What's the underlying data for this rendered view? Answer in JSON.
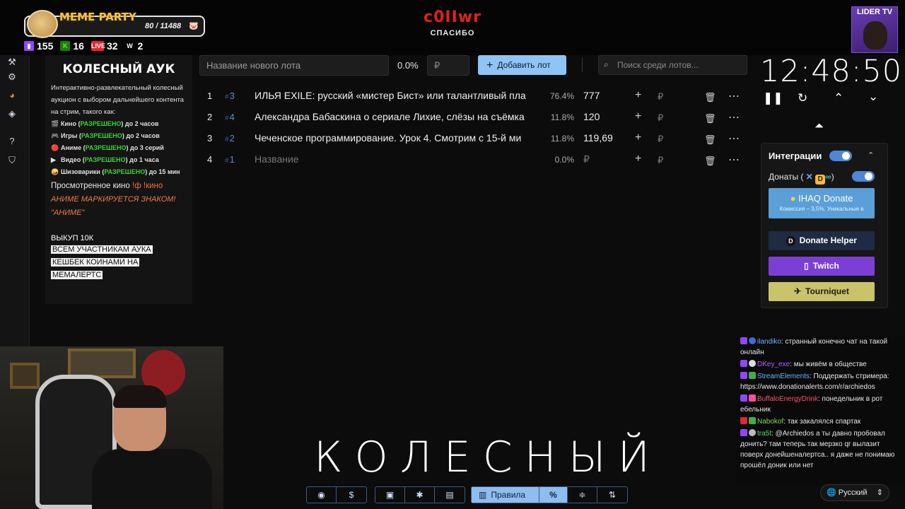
{
  "overlay": {
    "meme_title": "MEME PARTY",
    "meme_count": "80 / 11488",
    "meme_progress": 0.007,
    "stats": [
      {
        "icon": "twitch-icon",
        "color": "#9146ff",
        "value": "155"
      },
      {
        "icon": "kick-icon",
        "color": "#53fc18",
        "value": "16"
      },
      {
        "icon": "vk-live-icon",
        "color": "#e8242f",
        "value": "32"
      },
      {
        "icon": "w-icon",
        "color": "#ffffff",
        "value": "2"
      }
    ],
    "donor_name": "c0IIwr",
    "donor_thanks": "СПАСИБО",
    "channel_tag": "LIDER TV"
  },
  "info_panel": {
    "title": "КОЛЕСНЫЙ АУК",
    "description": "Интерактивно-развлекательный колесный аукцион с выбором дальнейшего контента на стрим, такого как:",
    "rules": [
      {
        "label": "Кино",
        "status": "РАЗРЕШЕНО",
        "limit": "до 2 часов"
      },
      {
        "label": "Игры",
        "status": "РАЗРЕШЕНО",
        "limit": "до 2 часов"
      },
      {
        "label": "Аниме",
        "status": "РАЗРЕШЕНО",
        "limit": "до 3 серий"
      },
      {
        "label": "Видео",
        "status": "РАЗРЕШЕНО",
        "limit": "до 1 часа"
      },
      {
        "label": "Шизоварики",
        "status": "РАЗРЕШЕНО",
        "limit": "до 15 мин"
      }
    ],
    "watched_label": "Просмотренное кино",
    "watched_cmd": "!ф !кино",
    "anime_note": "АНИМЕ МАРКИРУЕТСЯ ЗНАКОМ! \"АНИМЕ\"",
    "buyout": "ВЫКУП 10К",
    "cashback": [
      "ВСЕМ УЧАСТНИКАМ АУКА",
      "КЕШБЕК КОИНАМИ НА",
      "МЕМАЛЕРТС"
    ]
  },
  "toolbar": {
    "lot_placeholder": "Название нового лота",
    "percent": "0.0%",
    "rub_placeholder": "₽",
    "add_label": "Добавить лот",
    "search_placeholder": "Поиск среди лотов..."
  },
  "lots": [
    {
      "num": "1",
      "id": "3",
      "name": "ИЛЬЯ EXILE: русский «мистер Бист» или талантливый пла",
      "percent": "76.4%",
      "amount": "777"
    },
    {
      "num": "2",
      "id": "4",
      "name": "Александра Бабаскина о сериале Лихие, слёзы на съёмка",
      "percent": "11.8%",
      "amount": "120"
    },
    {
      "num": "3",
      "id": "2",
      "name": "Чеченское программирование. Урок 4. Смотрим с 15-й ми",
      "percent": "11.8%",
      "amount": "119,69"
    },
    {
      "num": "4",
      "id": "1",
      "name": "Название",
      "percent": "0.0%",
      "amount": "₽"
    }
  ],
  "timer": {
    "value": "12:48:50"
  },
  "integrations": {
    "title": "Интеграции",
    "donats_label": "Донаты (",
    "ihaq_title": "IHAQ Donate",
    "ihaq_sub": "Комиссия – 3,5%. Уникальные в",
    "donate_helper": "Donate Helper",
    "twitch": "Twitch",
    "tourniquet": "Tourniquet"
  },
  "chat": [
    {
      "user": "ilandiko",
      "color": "#6cb2ff",
      "text": "странный конечно чат на такой онлайн"
    },
    {
      "user": "DKey_exe",
      "color": "#b05cff",
      "text": "мы живём в обществе"
    },
    {
      "user": "StreamElements",
      "color": "#60b7ff",
      "text": "Поддержать стримера: https://www.donationalerts.com/r/archiedos"
    },
    {
      "user": "BuffaloEnergyDrink",
      "color": "#ff4f6a",
      "text": "понедельник в рот ебельник"
    },
    {
      "user": "Nabokof",
      "color": "#7ed957",
      "text": "так закалялся спартак"
    },
    {
      "user": "tra5t",
      "color": "#5bd16b",
      "text": "@Archiedos а ты давно пробовал донить? там теперь так мерзко qr вылазит поверх донейшеналертса.. я даже не понимаю прошёл доник или нет"
    }
  ],
  "language": "Русский",
  "big_word": "КОЛЕСНЫЙ",
  "bottom_bar": {
    "rules_label": "Правила"
  }
}
